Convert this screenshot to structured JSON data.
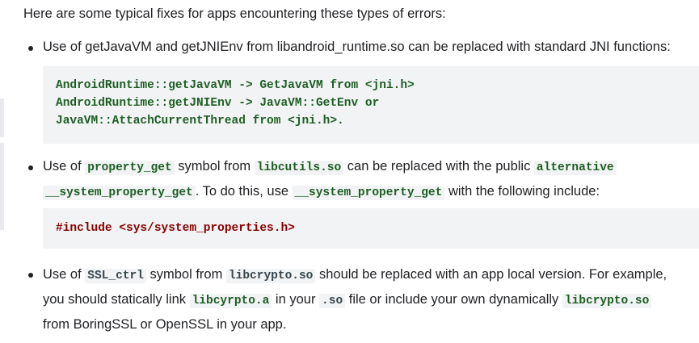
{
  "intro": "Here are some typical fixes for apps encountering these types of errors:",
  "bullets": [
    {
      "line1": "Use of getJavaVM and getJNIEnv from libandroid_runtime.so can be replaced with standard JNI functions:",
      "code": [
        "AndroidRuntime::getJavaVM -> GetJavaVM from <jni.h>",
        "AndroidRuntime::getJNIEnv -> JavaVM::GetEnv or",
        "JavaVM::AttachCurrentThread from <jni.h>."
      ]
    },
    {
      "p1": "Use of",
      "c1": "property_get",
      "p2": "symbol from",
      "c2": "libcutils.so",
      "p3": "can be replaced with the public",
      "c3": "alternative",
      "c4": "__system_property_get",
      "p4": ". To do this, use",
      "c5": "__system_property_get",
      "p5": "with the following include:",
      "code": "#include <sys/system_properties.h>"
    },
    {
      "p1": "Use of",
      "c1": "SSL_ctrl",
      "p2": "symbol from",
      "c2": "libcrypto.so",
      "p3": "should be replaced with an app local version. For example,",
      "p4": "you should statically link",
      "c3": "libcyrpto.a",
      "p5": "in your",
      "c4": ".so",
      "p6": "file or include your own dynamically",
      "c5": "libcrypto.so",
      "p7": "from BoringSSL or OpenSSL in your app."
    }
  ]
}
